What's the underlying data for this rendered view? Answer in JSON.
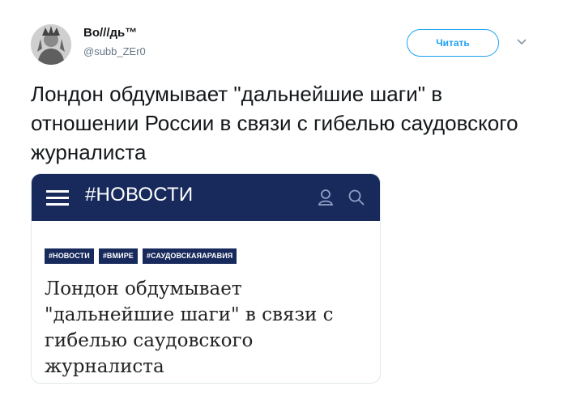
{
  "author": {
    "name": "Во///дь™",
    "handle": "@subb_ZEr0"
  },
  "follow_label": "Читать",
  "icons": {
    "more": "chevron-down-icon",
    "menu": "hamburger-icon",
    "user": "user-icon",
    "search": "search-icon"
  },
  "tweet_text": "Лондон обдумывает \"дальнейшие шаги\" в отношении России в связи с гибелью саудовского журналиста",
  "card": {
    "header_title": "#НОВОСТИ",
    "tags": [
      "#НОВОСТИ",
      "#ВМИРЕ",
      "#САУДОВСКАЯАРАВИЯ"
    ],
    "headline": "Лондон обдумывает \"дальнейшие шаги\" в связи с гибелью саудовского журналиста"
  },
  "colors": {
    "accent": "#1da1f2",
    "card_header": "#182a5c"
  }
}
